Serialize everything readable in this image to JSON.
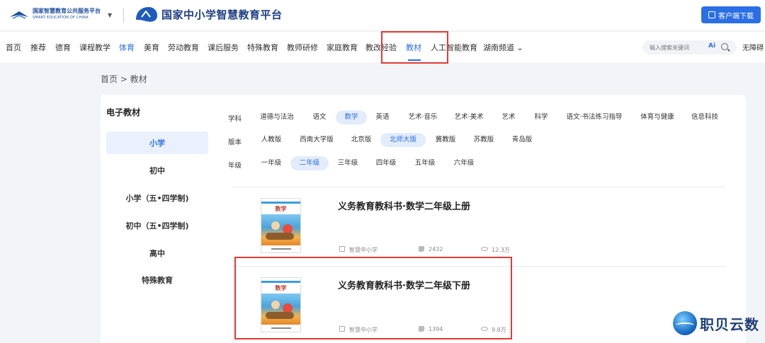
{
  "header": {
    "small_logo_line1": "国家智慧教育公共服务平台",
    "small_logo_line2": "SMART EDUCATION OF CHINA",
    "platform_name": "国家中小学智慧教育平台",
    "download_label": "客户端下载",
    "accent_color": "#2b6fe6"
  },
  "nav": {
    "items": [
      "首页",
      "推荐",
      "德育",
      "课程教学",
      "体育",
      "美育",
      "劳动教育",
      "课后服务",
      "特殊教育",
      "教师研修",
      "家庭教育",
      "教改经验",
      "教材",
      "人工智能教育",
      "湖南频道 ⌄"
    ],
    "active": "教材",
    "search_placeholder": "输入搜索关键词",
    "ai_label": "Ai",
    "user_label": "无障碍"
  },
  "breadcrumb": "首页 > 教材",
  "sidebar": {
    "title": "电子教材",
    "items": [
      "小学",
      "初中",
      "小学（五•四学制)",
      "初中（五•四学制)",
      "高中",
      "特殊教育"
    ],
    "active": "小学"
  },
  "filters": {
    "subject": {
      "label": "学科",
      "options": [
        "道德与法治",
        "语文",
        "数学",
        "英语",
        "艺术·音乐",
        "艺术·美术",
        "艺术",
        "科学",
        "语文·书法练习指导",
        "体育与健康",
        "信息科技"
      ],
      "selected": "数学"
    },
    "edition": {
      "label": "版本",
      "options": [
        "人教版",
        "西南大学版",
        "北京版",
        "北师大版",
        "冀教版",
        "苏教版",
        "青岛版"
      ],
      "selected": "北师大版"
    },
    "grade": {
      "label": "年级",
      "options": [
        "一年级",
        "二年级",
        "三年级",
        "四年级",
        "五年级",
        "六年级"
      ],
      "selected": "二年级"
    }
  },
  "books": [
    {
      "title": "义务教育教科书·数学二年级上册",
      "cover_title": "数学",
      "source": "智慧中小学",
      "likes": "2432",
      "views": "12.3万"
    },
    {
      "title": "义务教育教科书·数学二年级下册",
      "cover_title": "数学",
      "source": "智慧中小学",
      "likes": "1394",
      "views": "9.8万"
    }
  ],
  "watermark": "职贝云数"
}
